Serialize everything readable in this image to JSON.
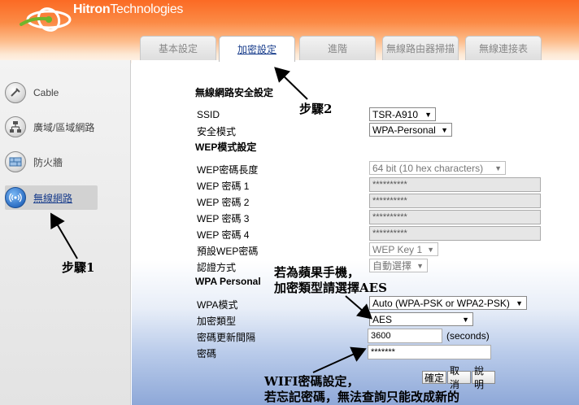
{
  "brand": {
    "name_bold": "Hitron",
    "name_light": "Technologies"
  },
  "sidebar": {
    "items": [
      {
        "label": "Cable",
        "icon": "cable-icon"
      },
      {
        "label": "廣域/區域網路",
        "icon": "network-icon"
      },
      {
        "label": "防火牆",
        "icon": "firewall-icon"
      },
      {
        "label": "無線網路",
        "icon": "wireless-icon",
        "active": true
      }
    ]
  },
  "tabs": [
    {
      "label": "基本設定",
      "active": false
    },
    {
      "label": "加密設定",
      "active": true
    },
    {
      "label": "進階",
      "active": false
    },
    {
      "label": "無線路由器掃描",
      "active": false
    },
    {
      "label": "無線連接表",
      "active": false
    }
  ],
  "form": {
    "section_title": "無線網路安全設定",
    "ssid_label": "SSID",
    "ssid_value": "TSR-A910",
    "security_mode_label": "安全模式",
    "security_mode_value": "WPA-Personal",
    "wep_section": "WEP模式設定",
    "wep_length_label": "WEP密碼長度",
    "wep_length_value": "64 bit (10 hex characters)",
    "wep_key1_label": "WEP 密碼 1",
    "wep_key1_value": "**********",
    "wep_key2_label": "WEP 密碼 2",
    "wep_key2_value": "**********",
    "wep_key3_label": "WEP 密碼 3",
    "wep_key3_value": "**********",
    "wep_key4_label": "WEP 密碼 4",
    "wep_key4_value": "**********",
    "default_key_label": "預設WEP密碼",
    "default_key_value": "WEP Key 1",
    "auth_label": "認證方式",
    "auth_value": "自動選擇",
    "wpa_section": "WPA Personal",
    "wpa_mode_label": "WPA模式",
    "wpa_mode_value": "Auto (WPA-PSK or WPA2-PSK)",
    "encryption_label": "加密類型",
    "encryption_value": "AES",
    "rekey_label": "密碼更新間隔",
    "rekey_value": "3600",
    "rekey_unit": "(seconds)",
    "password_label": "密碼",
    "password_value": "*******"
  },
  "buttons": {
    "confirm": "確定",
    "cancel": "取消",
    "help": "說明"
  },
  "annotations": {
    "step1": "步驟1",
    "step2": "步驟2",
    "iphone_line1": "若為蘋果手機，",
    "iphone_line2": "加密類型請選擇AES",
    "wifi_line1": "WIFI密碼設定，",
    "wifi_line2": "若忘記密碼，無法查詢只能改成新的"
  },
  "colors": {
    "header_orange": "#fb6a24",
    "link_blue": "#1a3e8c",
    "bottom_blue": "#8ea8d8"
  }
}
